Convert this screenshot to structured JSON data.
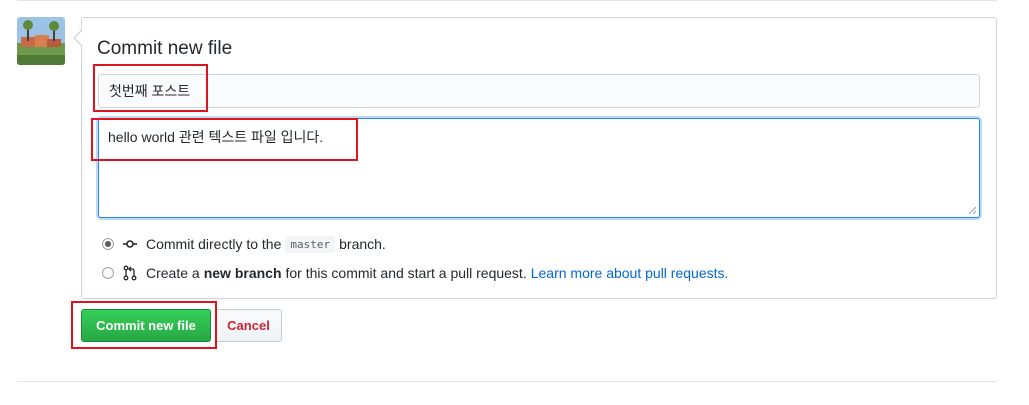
{
  "form": {
    "title": "Commit new file",
    "commit_message": "첫번째 포스트",
    "description": "hello world 관련 텍스트 파일 입니다."
  },
  "options": [
    {
      "selected": true,
      "icon": "git-commit-icon",
      "prefix": "Commit directly to the",
      "branch": "master",
      "suffix": "branch."
    },
    {
      "selected": false,
      "icon": "git-pull-request-icon",
      "prefix": "Create a",
      "bold": "new branch",
      "suffix": "for this commit and start a pull request.",
      "link": "Learn more about pull requests."
    }
  ],
  "buttons": {
    "commit": "Commit new file",
    "cancel": "Cancel"
  },
  "colors": {
    "commit_button": "#28a745",
    "cancel_text": "#cb2431",
    "link": "#0366d6",
    "highlight_box": "#e0141e"
  }
}
